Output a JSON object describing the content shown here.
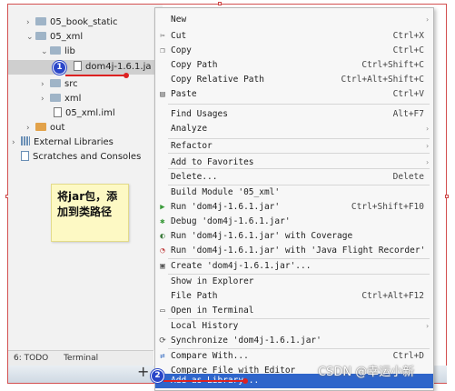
{
  "tree": {
    "items": [
      {
        "label": "05_book_static",
        "kind": "folder",
        "arrow": "›"
      },
      {
        "label": "05_xml",
        "kind": "folder",
        "arrow": "⌄"
      },
      {
        "label": "lib",
        "kind": "folder",
        "arrow": "⌄"
      },
      {
        "label": "dom4j-1.6.1.ja",
        "kind": "jar",
        "arrow": ""
      },
      {
        "label": "src",
        "kind": "folder",
        "arrow": "›"
      },
      {
        "label": "xml",
        "kind": "folder",
        "arrow": "›"
      },
      {
        "label": "05_xml.iml",
        "kind": "file",
        "arrow": ""
      },
      {
        "label": "out",
        "kind": "folder-orange",
        "arrow": "›"
      },
      {
        "label": "External Libraries",
        "kind": "lib",
        "arrow": "›"
      },
      {
        "label": "Scratches and Consoles",
        "kind": "scratch",
        "arrow": ""
      }
    ]
  },
  "note": {
    "text": "将jar包，添加到类路径"
  },
  "badges": {
    "first": "1",
    "second": "2"
  },
  "status": {
    "todo": "6: TODO",
    "terminal": "Terminal"
  },
  "menu": {
    "items": [
      {
        "label": "New",
        "shortcut": "",
        "submenu": true,
        "icon": ""
      },
      {
        "label": "Cut",
        "shortcut": "Ctrl+X",
        "submenu": false,
        "icon": "cut-icon"
      },
      {
        "label": "Copy",
        "shortcut": "Ctrl+C",
        "submenu": false,
        "icon": "copy-icon"
      },
      {
        "label": "Copy Path",
        "shortcut": "Ctrl+Shift+C",
        "submenu": false,
        "icon": ""
      },
      {
        "label": "Copy Relative Path",
        "shortcut": "Ctrl+Alt+Shift+C",
        "submenu": false,
        "icon": ""
      },
      {
        "label": "Paste",
        "shortcut": "Ctrl+V",
        "submenu": false,
        "icon": "paste-icon"
      },
      {
        "label": "Find Usages",
        "shortcut": "Alt+F7",
        "submenu": false,
        "icon": ""
      },
      {
        "label": "Analyze",
        "shortcut": "",
        "submenu": true,
        "icon": ""
      },
      {
        "label": "Refactor",
        "shortcut": "",
        "submenu": true,
        "icon": ""
      },
      {
        "label": "Add to Favorites",
        "shortcut": "",
        "submenu": true,
        "icon": ""
      },
      {
        "label": "Delete...",
        "shortcut": "Delete",
        "submenu": false,
        "icon": ""
      },
      {
        "label": "Build Module '05_xml'",
        "shortcut": "",
        "submenu": false,
        "icon": ""
      },
      {
        "label": "Run 'dom4j-1.6.1.jar'",
        "shortcut": "Ctrl+Shift+F10",
        "submenu": false,
        "icon": "run-icon"
      },
      {
        "label": "Debug 'dom4j-1.6.1.jar'",
        "shortcut": "",
        "submenu": false,
        "icon": "debug-icon"
      },
      {
        "label": "Run 'dom4j-1.6.1.jar' with Coverage",
        "shortcut": "",
        "submenu": false,
        "icon": "coverage-icon"
      },
      {
        "label": "Run 'dom4j-1.6.1.jar' with 'Java Flight Recorder'",
        "shortcut": "",
        "submenu": false,
        "icon": "profiler-icon"
      },
      {
        "label": "Create 'dom4j-1.6.1.jar'...",
        "shortcut": "",
        "submenu": false,
        "icon": "config-icon"
      },
      {
        "label": "Show in Explorer",
        "shortcut": "",
        "submenu": false,
        "icon": ""
      },
      {
        "label": "File Path",
        "shortcut": "Ctrl+Alt+F12",
        "submenu": false,
        "icon": ""
      },
      {
        "label": "Open in Terminal",
        "shortcut": "",
        "submenu": false,
        "icon": "terminal-icon"
      },
      {
        "label": "Local History",
        "shortcut": "",
        "submenu": true,
        "icon": ""
      },
      {
        "label": "Synchronize 'dom4j-1.6.1.jar'",
        "shortcut": "",
        "submenu": false,
        "icon": "sync-icon"
      },
      {
        "label": "Compare With...",
        "shortcut": "Ctrl+D",
        "submenu": false,
        "icon": "compare-icon"
      },
      {
        "label": "Compare File with Editor",
        "shortcut": "",
        "submenu": false,
        "icon": ""
      },
      {
        "label": "Add as Library...",
        "shortcut": "",
        "submenu": false,
        "icon": ""
      }
    ]
  },
  "watermark": "CSDN @幸运小新",
  "colors": {
    "highlight": "#2f65ca",
    "annotation_red": "#d22222",
    "badge_blue": "#2a46c8",
    "note_yellow": "#fdf9c4"
  }
}
